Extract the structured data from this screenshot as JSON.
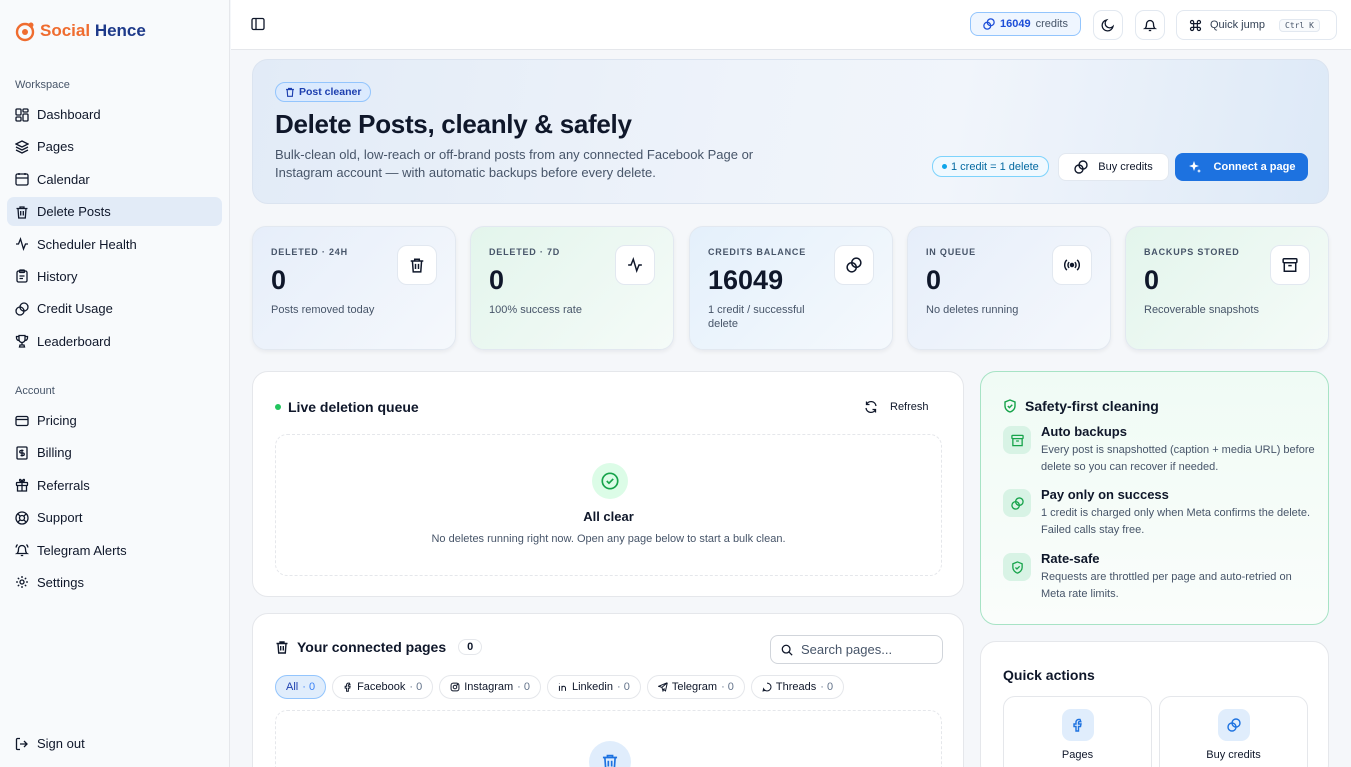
{
  "app": {
    "logo_prefix": "Social",
    "logo_suffix": " Hence"
  },
  "sidebar": {
    "workspace_label": "Workspace",
    "workspace_items": [
      {
        "label": "Dashboard",
        "icon": "dashboard-icon"
      },
      {
        "label": "Pages",
        "icon": "layers-icon"
      },
      {
        "label": "Calendar",
        "icon": "calendar-icon"
      },
      {
        "label": "Delete Posts",
        "icon": "trash-icon",
        "active": true
      },
      {
        "label": "Scheduler Health",
        "icon": "activity-icon"
      },
      {
        "label": "History",
        "icon": "clipboard-icon"
      },
      {
        "label": "Credit Usage",
        "icon": "coins-icon"
      },
      {
        "label": "Leaderboard",
        "icon": "trophy-icon"
      }
    ],
    "account_label": "Account",
    "account_items": [
      {
        "label": "Pricing",
        "icon": "credit-card-icon"
      },
      {
        "label": "Billing",
        "icon": "receipt-icon"
      },
      {
        "label": "Referrals",
        "icon": "gift-icon"
      },
      {
        "label": "Support",
        "icon": "lifebuoy-icon"
      },
      {
        "label": "Telegram Alerts",
        "icon": "bell-ring-icon"
      },
      {
        "label": "Settings",
        "icon": "gear-icon"
      }
    ],
    "signout_label": "Sign out"
  },
  "topbar": {
    "credits_value": "16049",
    "credits_label": "credits",
    "quick_jump_label": "Quick jump",
    "quick_jump_shortcut": "Ctrl K"
  },
  "hero": {
    "badge": "Post cleaner",
    "title": "Delete Posts, cleanly & safely",
    "description": "Bulk-clean old, low-reach or off-brand posts from any connected Facebook Page or Instagram account — with automatic backups before every delete.",
    "rate_pill": "1 credit = 1 delete",
    "buy_credits_label": "Buy credits",
    "connect_label": "Connect a page"
  },
  "stats": [
    {
      "label": "DELETED · 24H",
      "value": "0",
      "sub": "Posts removed today",
      "icon": "trash-icon",
      "bg": "#e6eefa"
    },
    {
      "label": "DELETED · 7D",
      "value": "0",
      "sub": "100% success rate",
      "icon": "activity-icon",
      "bg": "#e3f5ec"
    },
    {
      "label": "CREDITS BALANCE",
      "value": "16049",
      "sub": "1 credit / successful delete",
      "icon": "coins-icon",
      "bg": "#e4f0fb"
    },
    {
      "label": "IN QUEUE",
      "value": "0",
      "sub": "No deletes running",
      "icon": "radio-icon",
      "bg": "#e6eefa"
    },
    {
      "label": "BACKUPS STORED",
      "value": "0",
      "sub": "Recoverable snapshots",
      "icon": "archive-icon",
      "bg": "#e3f5ec"
    }
  ],
  "queue": {
    "title": "Live deletion queue",
    "refresh_label": "Refresh",
    "empty_title": "All clear",
    "empty_text": "No deletes running right now. Open any page below to start a bulk clean."
  },
  "pages": {
    "title": "Your connected pages",
    "count": "0",
    "search_placeholder": "Search pages...",
    "filters": [
      {
        "label": "All",
        "count": "· 0",
        "active": true,
        "icon": ""
      },
      {
        "label": "Facebook",
        "count": "· 0",
        "icon": "facebook-icon"
      },
      {
        "label": "Instagram",
        "count": "· 0",
        "icon": "instagram-icon"
      },
      {
        "label": "Linkedin",
        "count": "· 0",
        "icon": "linkedin-icon"
      },
      {
        "label": "Telegram",
        "count": "· 0",
        "icon": "telegram-icon"
      },
      {
        "label": "Threads",
        "count": "· 0",
        "icon": "threads-icon"
      }
    ]
  },
  "safety": {
    "title": "Safety-first cleaning",
    "items": [
      {
        "title": "Auto backups",
        "text": "Every post is snapshotted (caption + media URL) before delete so you can recover if needed.",
        "icon": "archive-icon"
      },
      {
        "title": "Pay only on success",
        "text": "1 credit is charged only when Meta confirms the delete. Failed calls stay free.",
        "icon": "coins-icon"
      },
      {
        "title": "Rate-safe",
        "text": "Requests are throttled per page and auto-retried on Meta rate limits.",
        "icon": "shield-check-icon"
      }
    ]
  },
  "quick_actions": {
    "title": "Quick actions",
    "items": [
      {
        "label": "Pages",
        "icon": "facebook-icon"
      },
      {
        "label": "Buy credits",
        "icon": "coins-icon"
      }
    ]
  },
  "colors": {
    "accent": "#1d72e0",
    "success": "#22c55e",
    "logo_orange": "#ef6c2f",
    "logo_navy": "#1e3a8a"
  }
}
